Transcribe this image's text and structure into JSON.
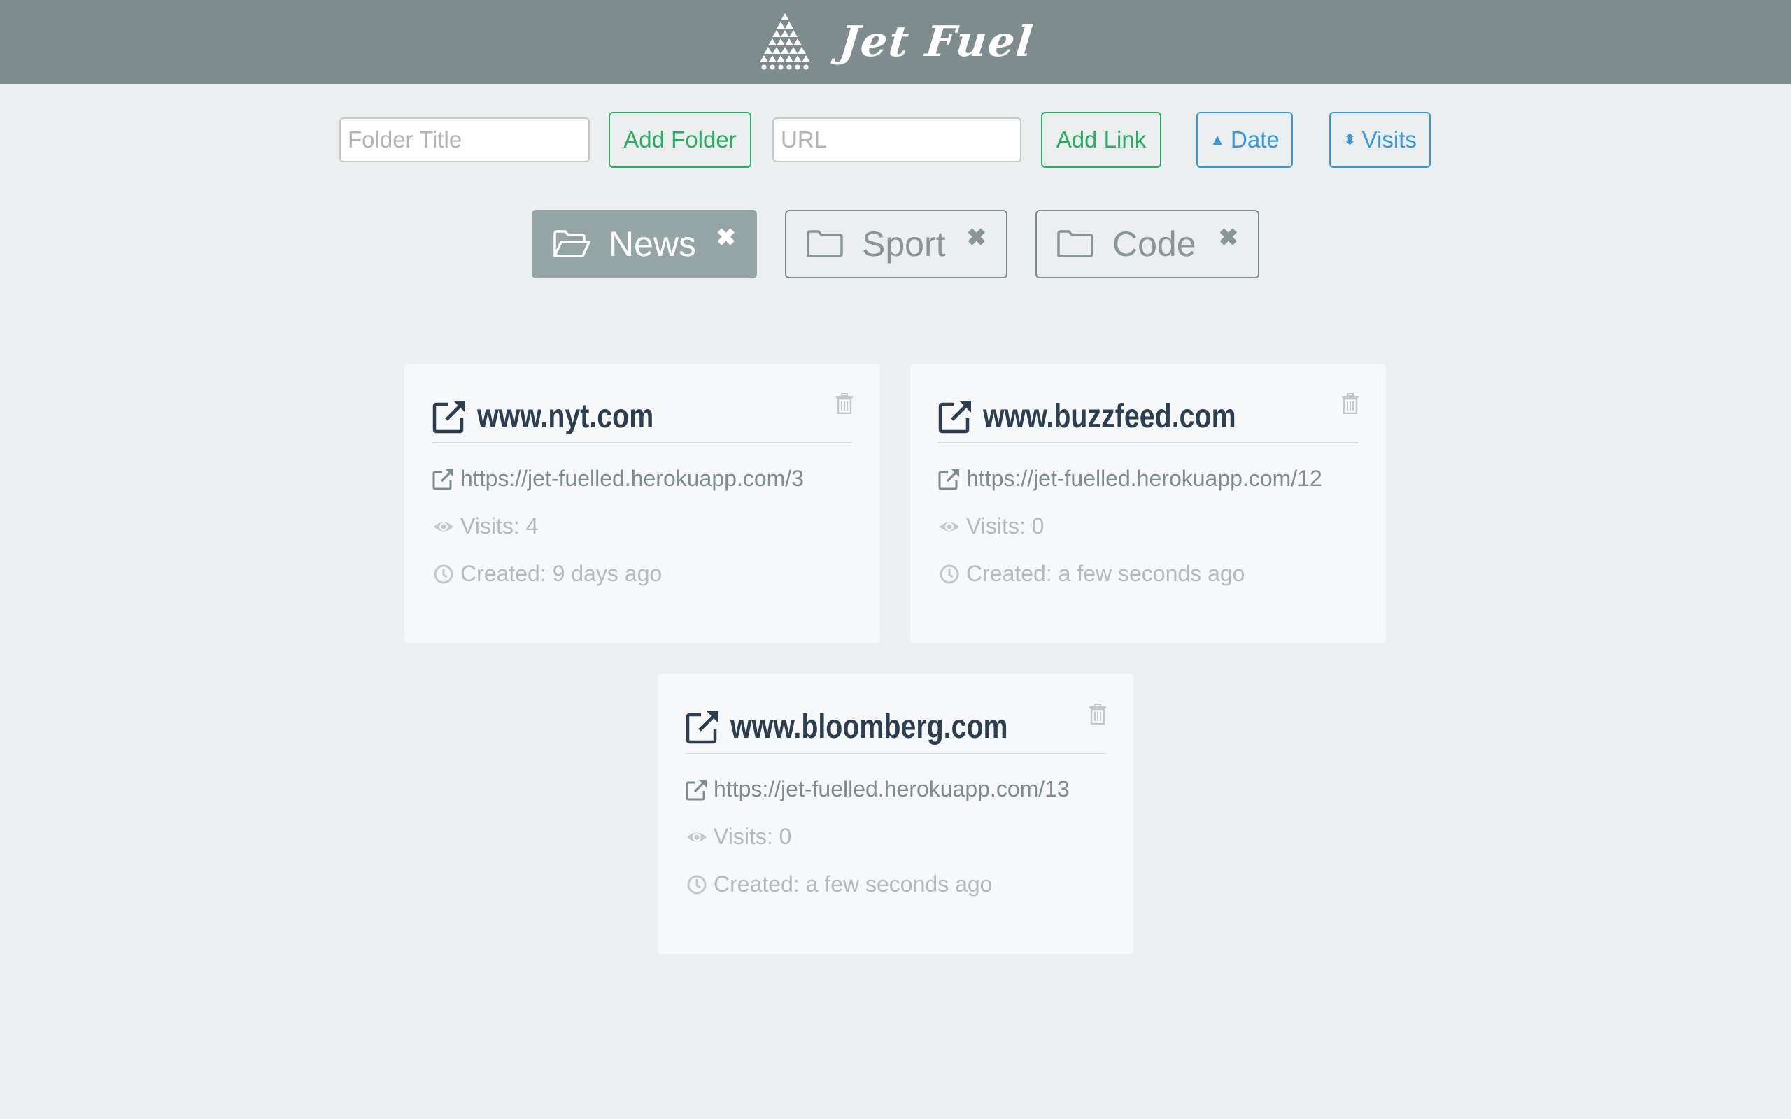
{
  "app": {
    "title": "Jet Fuel"
  },
  "toolbar": {
    "folder_placeholder": "Folder Title",
    "add_folder_label": "Add Folder",
    "url_placeholder": "URL",
    "add_link_label": "Add Link",
    "sort_date_label": "Date",
    "sort_visits_label": "Visits"
  },
  "folders": [
    {
      "label": "News",
      "active": true
    },
    {
      "label": "Sport",
      "active": false
    },
    {
      "label": "Code",
      "active": false
    }
  ],
  "links": [
    {
      "title": "www.nyt.com",
      "short_url": "https://jet-fuelled.herokuapp.com/3",
      "visits": "Visits: 4",
      "created": "Created: 9 days ago"
    },
    {
      "title": "www.buzzfeed.com",
      "short_url": "https://jet-fuelled.herokuapp.com/12",
      "visits": "Visits: 0",
      "created": "Created: a few seconds ago"
    },
    {
      "title": "www.bloomberg.com",
      "short_url": "https://jet-fuelled.herokuapp.com/13",
      "visits": "Visits: 0",
      "created": "Created: a few seconds ago"
    }
  ],
  "colors": {
    "header_bg": "#7f8c8d",
    "page_bg": "#ebeff0",
    "green": "#27ae60",
    "blue": "#3498db",
    "title_text": "#2c3e50"
  }
}
